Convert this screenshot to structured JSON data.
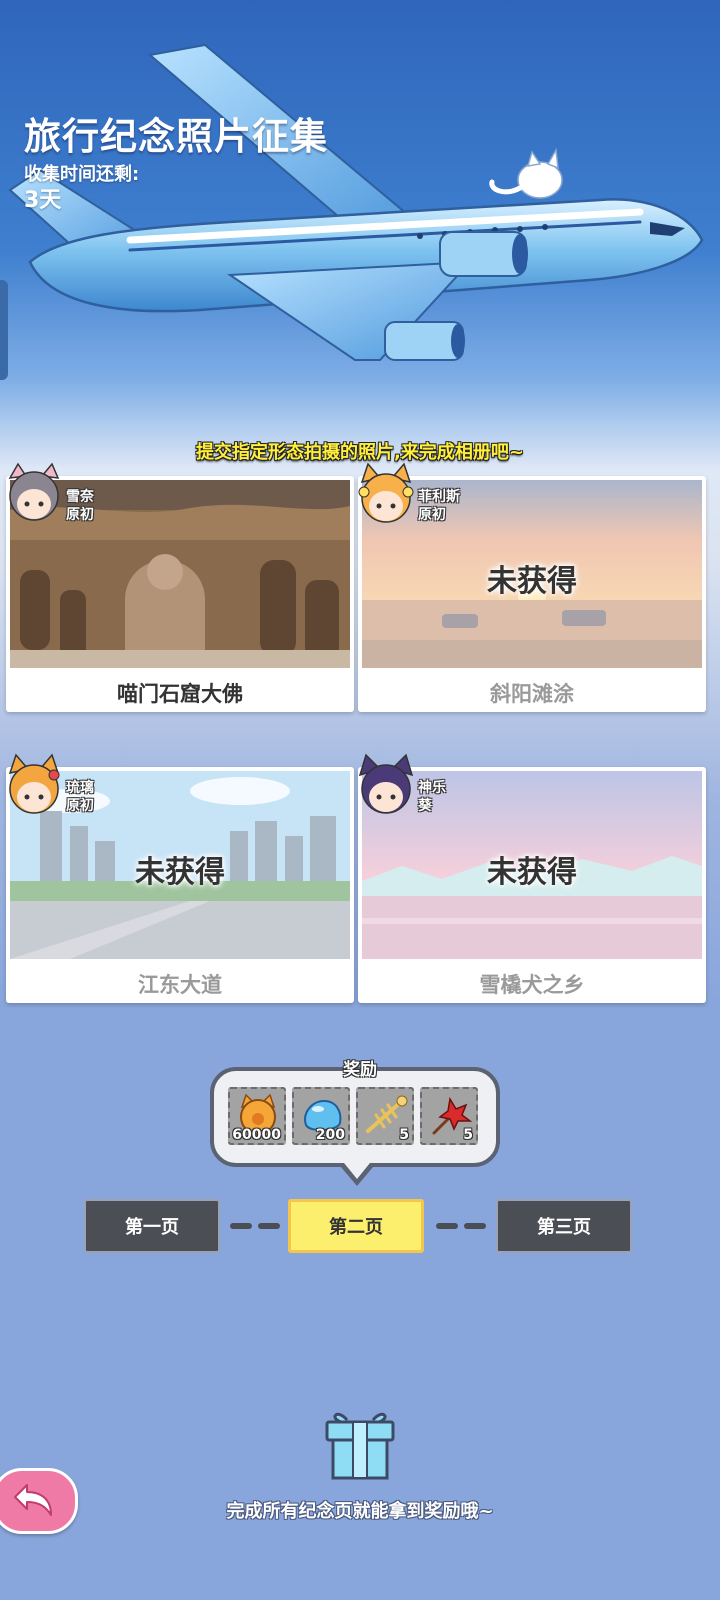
{
  "header": {
    "title": "旅行纪念照片征集",
    "timer_label": "收集时间还剩:",
    "timer_value": "3天"
  },
  "subtitle": "提交指定形态拍摄的照片,来完成相册吧~",
  "cards": [
    {
      "character": [
        "雪奈",
        "原初"
      ],
      "name": "喵门石窟大佛",
      "status": "owned"
    },
    {
      "character": [
        "菲利斯",
        "原初"
      ],
      "name": "斜阳滩涂",
      "status": "未获得"
    },
    {
      "character": [
        "琉璃",
        "原初"
      ],
      "name": "江东大道",
      "status": "未获得"
    },
    {
      "character": [
        "神乐",
        "葵"
      ],
      "name": "雪橇犬之乡",
      "status": "未获得"
    }
  ],
  "reward": {
    "label": "奖励",
    "items": [
      {
        "icon": "cat-coin-icon",
        "count": "60000"
      },
      {
        "icon": "blue-slime-icon",
        "count": "200"
      },
      {
        "icon": "fish-bone-icon",
        "count": "5"
      },
      {
        "icon": "red-flower-icon",
        "count": "5"
      }
    ]
  },
  "pages": {
    "first": "第一页",
    "second": "第二页",
    "third": "第三页",
    "active": "第二页"
  },
  "bottom_note": "完成所有纪念页就能拿到奖励哦~",
  "colors": {
    "active_page": "#fdef6e",
    "inactive_page": "#4b4e54",
    "back_button": "#f07aa6",
    "subtitle_text": "#ffef3a"
  }
}
